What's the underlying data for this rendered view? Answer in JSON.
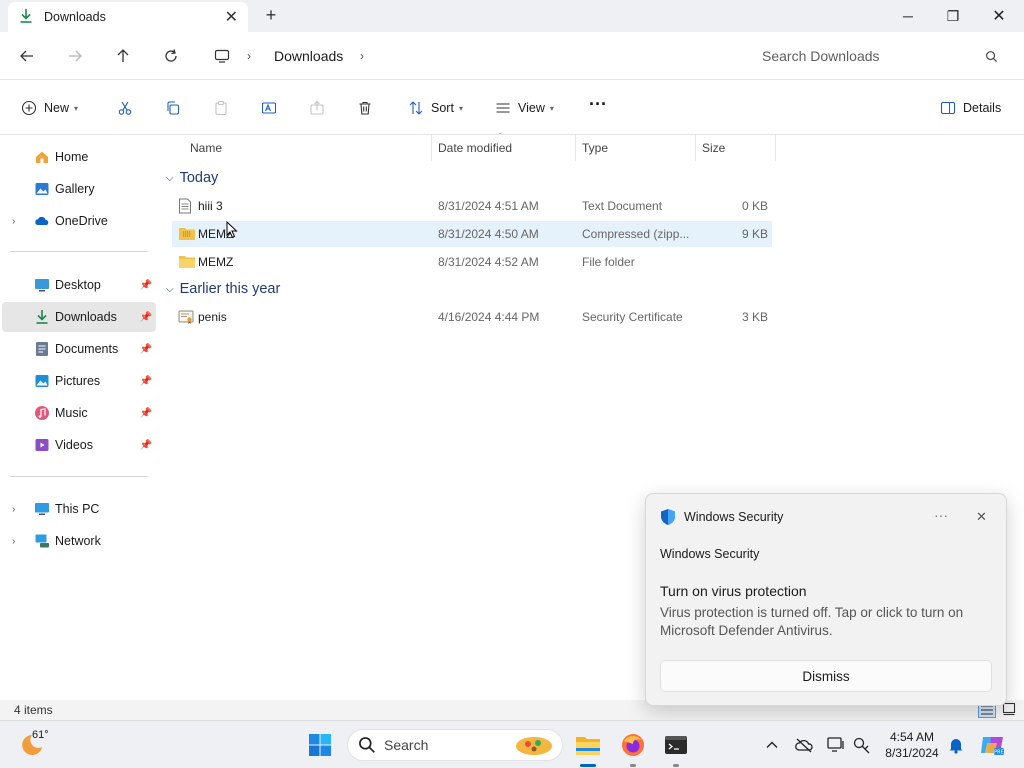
{
  "window": {
    "tab_title": "Downloads",
    "tab_close": "✕",
    "new_tab": "+",
    "minimize": "─",
    "maximize": "❐",
    "close": "✕"
  },
  "address": {
    "breadcrumb": [
      "Downloads"
    ],
    "search_placeholder": "Search Downloads"
  },
  "commands": {
    "new": "New",
    "sort": "Sort",
    "view": "View",
    "more": "···",
    "details": "Details"
  },
  "sidebar": {
    "quick": [
      {
        "label": "Home",
        "icon": "home-icon"
      },
      {
        "label": "Gallery",
        "icon": "gallery-icon"
      },
      {
        "label": "OneDrive",
        "icon": "onedrive-icon"
      }
    ],
    "pinned": [
      {
        "label": "Desktop",
        "icon": "desktop-icon"
      },
      {
        "label": "Downloads",
        "icon": "downloads-icon"
      },
      {
        "label": "Documents",
        "icon": "documents-icon"
      },
      {
        "label": "Pictures",
        "icon": "pictures-icon"
      },
      {
        "label": "Music",
        "icon": "music-icon"
      },
      {
        "label": "Videos",
        "icon": "videos-icon"
      }
    ],
    "system": [
      {
        "label": "This PC",
        "icon": "this-pc-icon"
      },
      {
        "label": "Network",
        "icon": "network-icon"
      }
    ]
  },
  "columns": {
    "name": "Name",
    "date": "Date modified",
    "type": "Type",
    "size": "Size"
  },
  "groups": [
    {
      "label": "Today",
      "files": [
        {
          "name": "hiii 3",
          "date": "8/31/2024 4:51 AM",
          "type": "Text Document",
          "size": "0 KB",
          "icon": "text-file-icon"
        },
        {
          "name": "MEMZ",
          "date": "8/31/2024 4:50 AM",
          "type": "Compressed (zipp...",
          "size": "9 KB",
          "icon": "zip-folder-icon"
        },
        {
          "name": "MEMZ",
          "date": "8/31/2024 4:52 AM",
          "type": "File folder",
          "size": "",
          "icon": "folder-icon"
        }
      ]
    },
    {
      "label": "Earlier this year",
      "files": [
        {
          "name": "penis",
          "date": "4/16/2024 4:44 PM",
          "type": "Security Certificate",
          "size": "3 KB",
          "icon": "certificate-icon"
        }
      ]
    }
  ],
  "status": {
    "items": "4 items"
  },
  "toast": {
    "app": "Windows Security",
    "source": "Windows Security",
    "title": "Turn on virus protection",
    "body": "Virus protection is turned off. Tap or click to turn on Microsoft Defender Antivirus.",
    "more": "···",
    "close": "✕",
    "dismiss": "Dismiss"
  },
  "taskbar": {
    "weather": "61°",
    "search": "Search",
    "time": "4:54 AM",
    "date": "8/31/2024"
  },
  "colors": {
    "accent": "#0067c0",
    "folder": "#f0c24b",
    "hover_row": "#e5f1fb",
    "group_text": "#1f3c74"
  }
}
